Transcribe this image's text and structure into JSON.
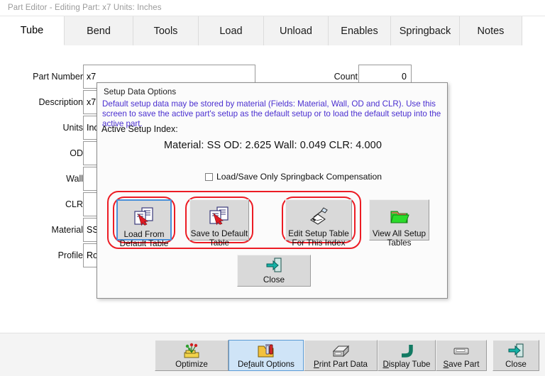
{
  "window": {
    "title": "Part Editor - Editing Part: x7  Units: Inches"
  },
  "tabs": [
    {
      "label": "Tube",
      "active": true
    },
    {
      "label": "Bend",
      "active": false
    },
    {
      "label": "Tools",
      "active": false
    },
    {
      "label": "Load",
      "active": false
    },
    {
      "label": "Unload",
      "active": false
    },
    {
      "label": "Enables",
      "active": false
    },
    {
      "label": "Springback",
      "active": false
    },
    {
      "label": "Notes",
      "active": false
    }
  ],
  "form": {
    "fields": [
      {
        "label": "Part Number",
        "value": "x7"
      },
      {
        "label": "Description",
        "value": "x7"
      },
      {
        "label": "Units",
        "value": "Inches"
      },
      {
        "label": "OD",
        "value": ""
      },
      {
        "label": "Wall",
        "value": ""
      },
      {
        "label": "CLR",
        "value": ""
      },
      {
        "label": "Material",
        "value": "SS"
      },
      {
        "label": "Profile",
        "value": "Round"
      }
    ],
    "count": {
      "label": "Count",
      "value": "0"
    }
  },
  "dialog": {
    "title": "Setup Data Options",
    "description": "Default setup data may be stored by material (Fields: Material, Wall, OD and CLR).   Use this screen to save the active part's setup as the default setup or to load the default setup into the active part.",
    "index_label": "Active Setup Index:",
    "index_value": "Material: SS   OD: 2.625   Wall: 0.049   CLR: 4.000",
    "checkbox": {
      "label": "Load/Save Only Springback Compensation",
      "checked": false
    },
    "buttons": [
      {
        "label": "Load From\nDefault Table",
        "icon": "copy-from-table-icon",
        "highlighted": true,
        "focused": true
      },
      {
        "label": "Save to Default\nTable",
        "icon": "copy-to-table-icon",
        "highlighted": true,
        "focused": false
      },
      {
        "label": "Edit Setup Table\nFor This Index",
        "icon": "edit-pencil-icon",
        "highlighted": true,
        "focused": false
      },
      {
        "label": "View All Setup\nTables",
        "icon": "folder-open-icon",
        "highlighted": false,
        "focused": false
      }
    ],
    "close_button": {
      "label": "Close",
      "icon": "exit-door-icon"
    }
  },
  "toolbar": {
    "buttons": [
      {
        "label": "Optimize",
        "icon": "optimize-icon",
        "accel": "",
        "active": false
      },
      {
        "label": "Default Options",
        "icon": "options-icon",
        "accel": "f",
        "active": true
      },
      {
        "label": "Print Part Data",
        "icon": "printer-icon",
        "accel": "P",
        "active": false
      },
      {
        "label": "Display Tube",
        "icon": "tube-bend-icon",
        "accel": "D",
        "active": false
      },
      {
        "label": "Save Part",
        "icon": "save-disk-icon",
        "accel": "S",
        "active": false
      },
      {
        "label": "Close",
        "icon": "exit-door-icon",
        "accel": "",
        "active": false
      }
    ]
  },
  "colors": {
    "annotation_red": "#ec1c24",
    "dialog_link_text": "#4a2fd0",
    "active_button": "#cfe4f7",
    "button_face": "#d9d9d9"
  }
}
